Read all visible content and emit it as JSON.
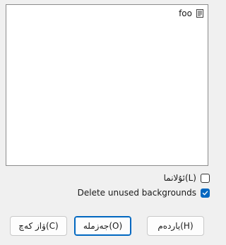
{
  "list": {
    "items": [
      {
        "label": "foo",
        "icon": "document-icon"
      }
    ]
  },
  "options": {
    "stretch_label": "ئۇلانما(L)",
    "stretch_checked": false,
    "delete_unused_label": "Delete unused backgrounds",
    "delete_unused_checked": true
  },
  "buttons": {
    "cancel_label": "ۋاز كەچ(C)",
    "ok_label": "جەزملە(O)",
    "help_label": "ياردەم(H)"
  },
  "colors": {
    "accent": "#0067c0"
  }
}
